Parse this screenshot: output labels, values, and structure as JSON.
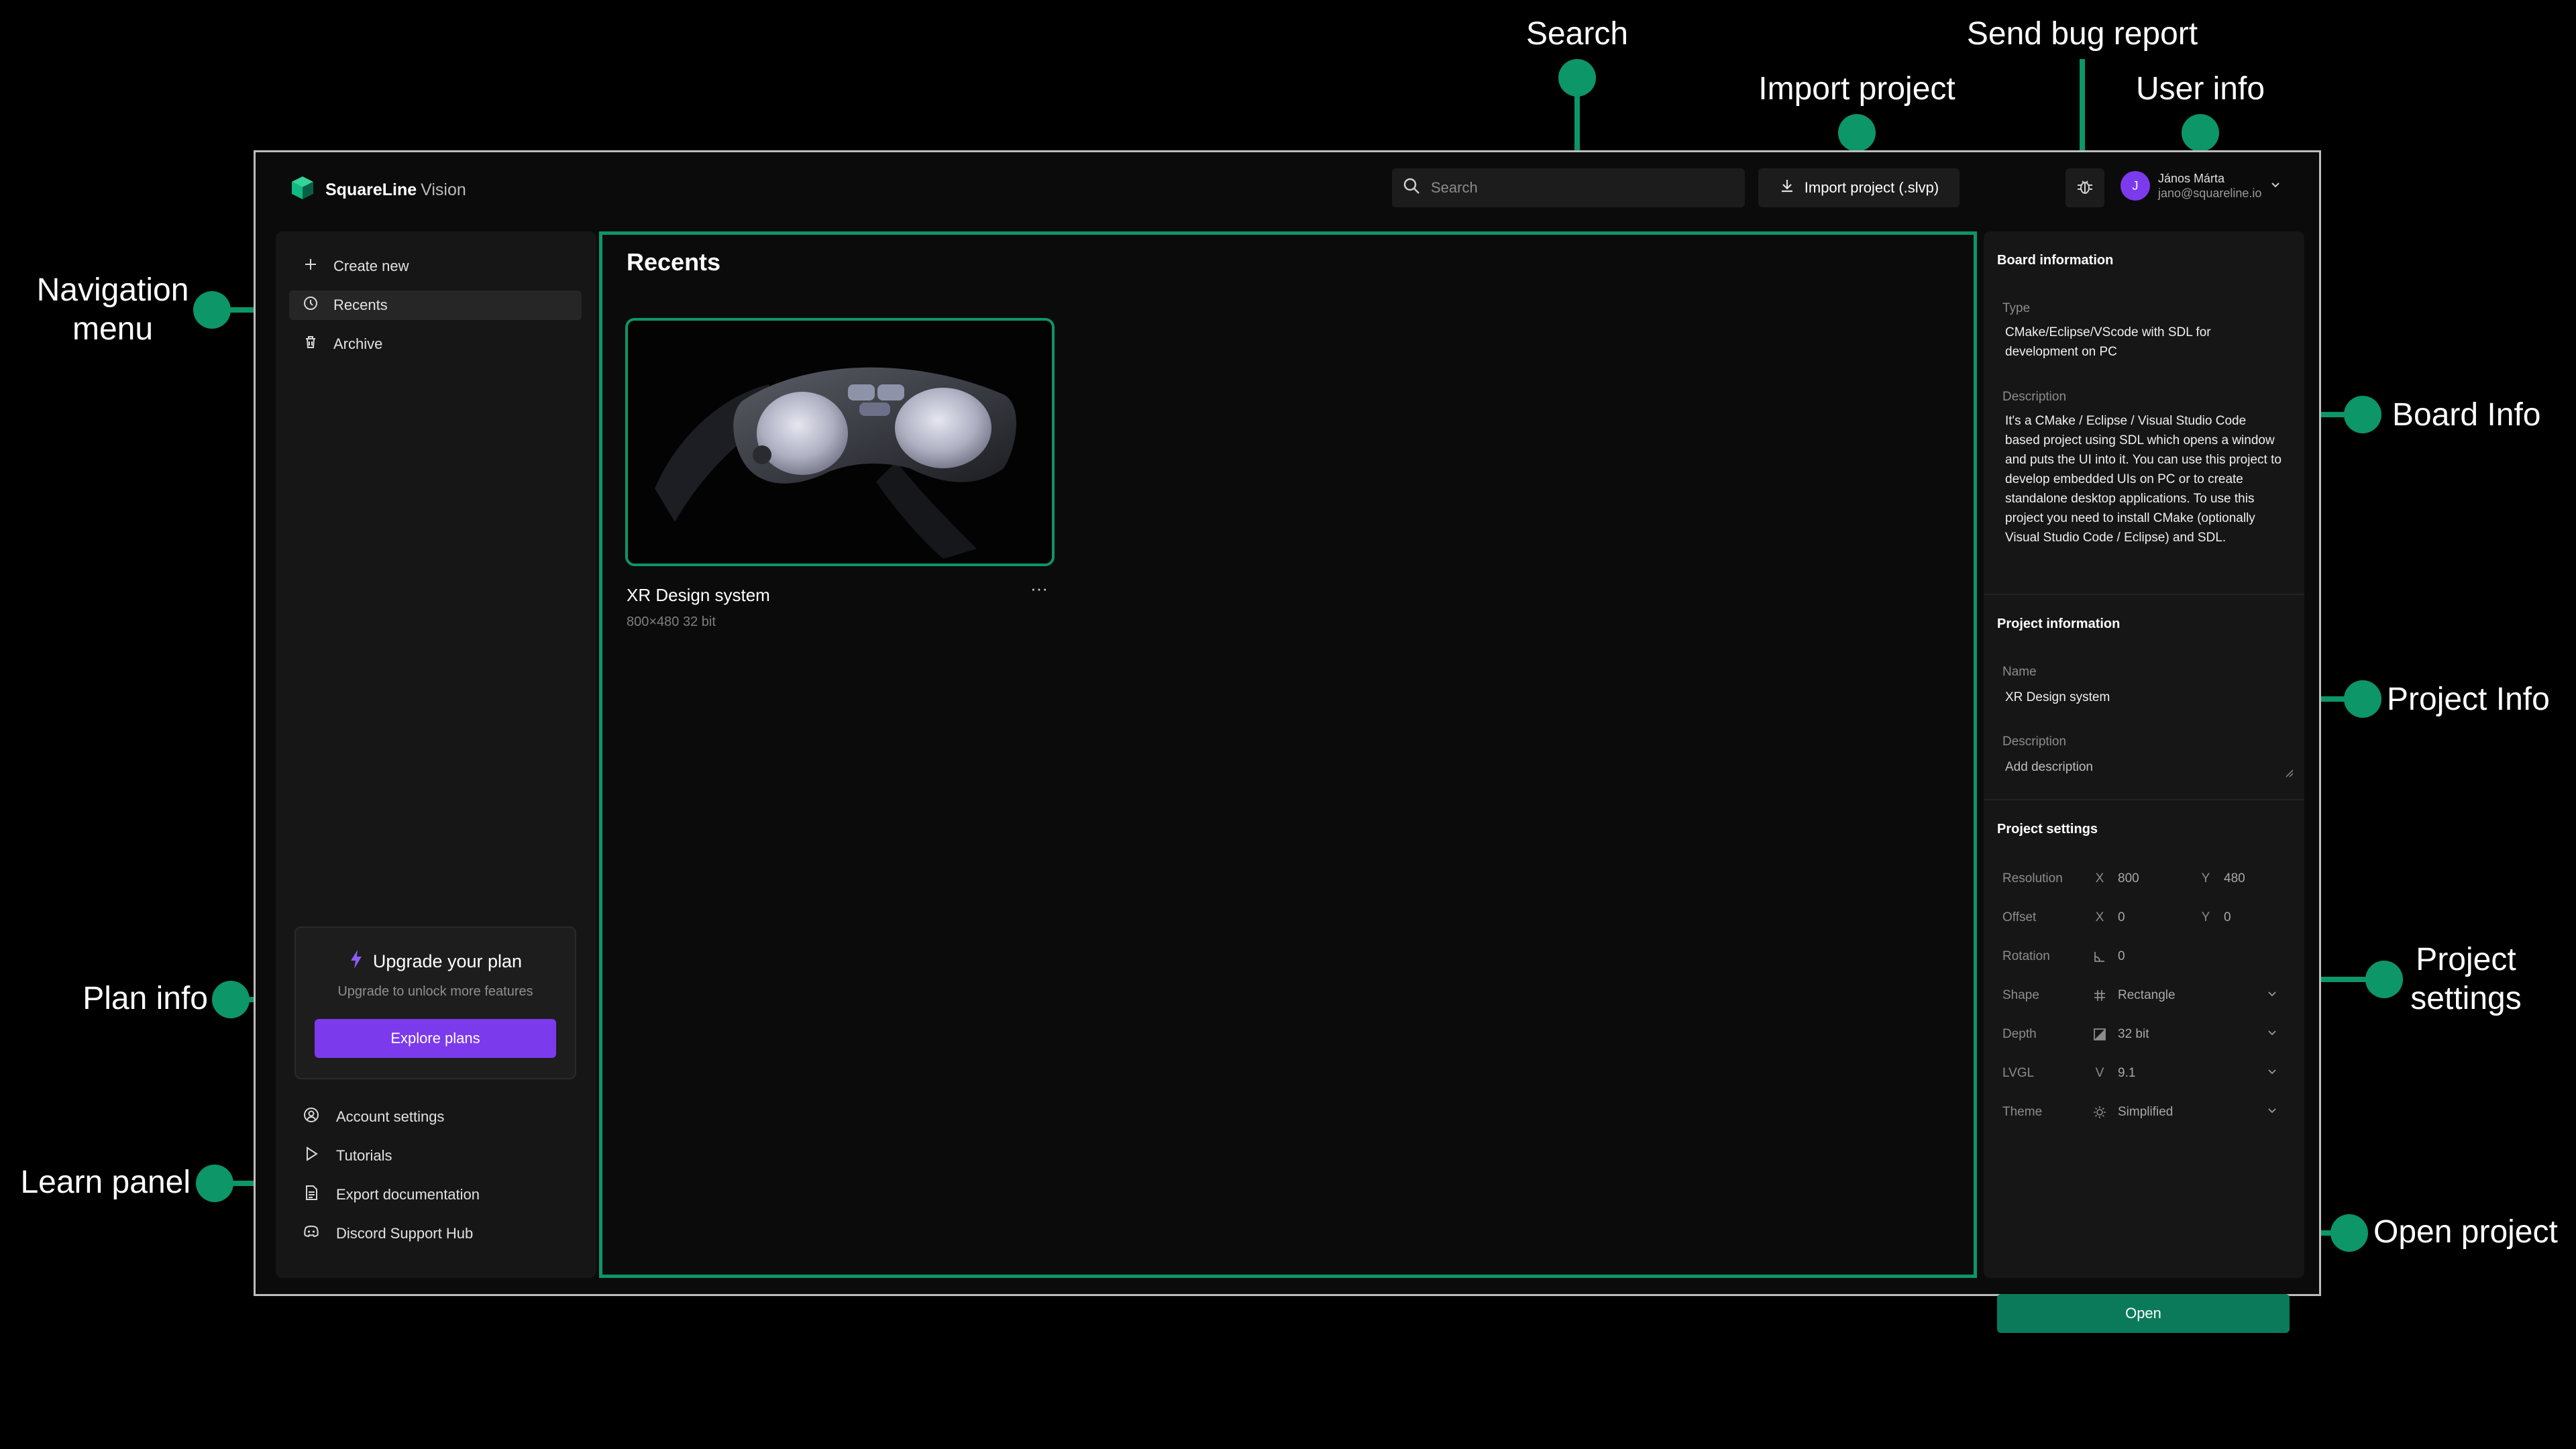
{
  "annotations": {
    "search": "Search",
    "send_bug_report": "Send bug report",
    "import_project": "Import project",
    "user_info": "User info",
    "navigation_menu": "Navigation\nmenu",
    "board_info": "Board Info",
    "project_info": "Project Info",
    "plan_info": "Plan info",
    "project_settings": "Project\nsettings",
    "learn_panel": "Learn panel",
    "open_project": "Open project",
    "accent_color": "#0d9668"
  },
  "app": {
    "brand": "SquareLine",
    "product": "Vision"
  },
  "header": {
    "search_placeholder": "Search",
    "import_label": "Import project (.slvp)",
    "user": {
      "initial": "J",
      "name": "János Márta",
      "email": "jano@squareline.io"
    }
  },
  "sidebar": {
    "items": [
      {
        "label": "Create new",
        "icon": "plus-icon"
      },
      {
        "label": "Recents",
        "icon": "clock-icon",
        "active": true
      },
      {
        "label": "Archive",
        "icon": "trash-icon"
      }
    ],
    "plan": {
      "title": "Upgrade your plan",
      "subtitle": "Upgrade to unlock more features",
      "button": "Explore plans",
      "button_color": "#7c3aed"
    },
    "learn": [
      {
        "label": "Account settings",
        "icon": "user-circle-icon"
      },
      {
        "label": "Tutorials",
        "icon": "play-icon"
      },
      {
        "label": "Export documentation",
        "icon": "document-icon"
      },
      {
        "label": "Discord Support Hub",
        "icon": "discord-icon"
      }
    ]
  },
  "main": {
    "title": "Recents",
    "project": {
      "name": "XR Design system",
      "meta": "800×480 32 bit",
      "more": "···"
    }
  },
  "right_panel": {
    "board": {
      "title": "Board information",
      "type_label": "Type",
      "type_value": "CMake/Eclipse/VScode with SDL for development on PC",
      "desc_label": "Description",
      "desc_value": "It's a CMake / Eclipse / Visual Studio Code based project using SDL which opens a window and puts the UI into it. You can use this project to develop embedded UIs on PC or to create standalone desktop applications. To use this project you need to install CMake (optionally Visual Studio Code / Eclipse) and SDL."
    },
    "project": {
      "title": "Project information",
      "name_label": "Name",
      "name_value": "XR Design system",
      "desc_label": "Description",
      "desc_placeholder": "Add description"
    },
    "settings": {
      "title": "Project settings",
      "resolution": {
        "label": "Resolution",
        "x_label": "X",
        "x": "800",
        "y_label": "Y",
        "y": "480"
      },
      "offset": {
        "label": "Offset",
        "x_label": "X",
        "x": "0",
        "y_label": "Y",
        "y": "0"
      },
      "rotation": {
        "label": "Rotation",
        "value": "0"
      },
      "shape": {
        "label": "Shape",
        "value": "Rectangle"
      },
      "depth": {
        "label": "Depth",
        "value": "32 bit"
      },
      "lvgl": {
        "label": "LVGL",
        "prefix": "V",
        "value": "9.1"
      },
      "theme": {
        "label": "Theme",
        "value": "Simplified"
      }
    },
    "open_button": "Open",
    "open_color": "#0b7a5a"
  }
}
